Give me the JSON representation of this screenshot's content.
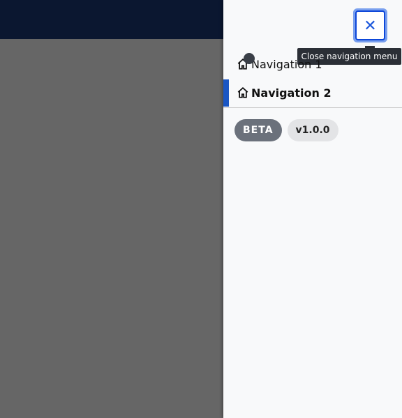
{
  "header": {
    "close_button_icon": "close-icon",
    "tooltip": "Close navigation menu"
  },
  "nav": {
    "items": [
      {
        "label": "Navigation 1",
        "icon": "home-icon",
        "active": false
      },
      {
        "label": "Navigation 2",
        "icon": "home-icon",
        "active": true
      }
    ]
  },
  "badges": {
    "beta": "BETA",
    "version": "v1.0.0"
  },
  "colors": {
    "topbar": "#0b1730",
    "accent": "#1a56c4",
    "focus_ring": "#7aa0ee"
  }
}
